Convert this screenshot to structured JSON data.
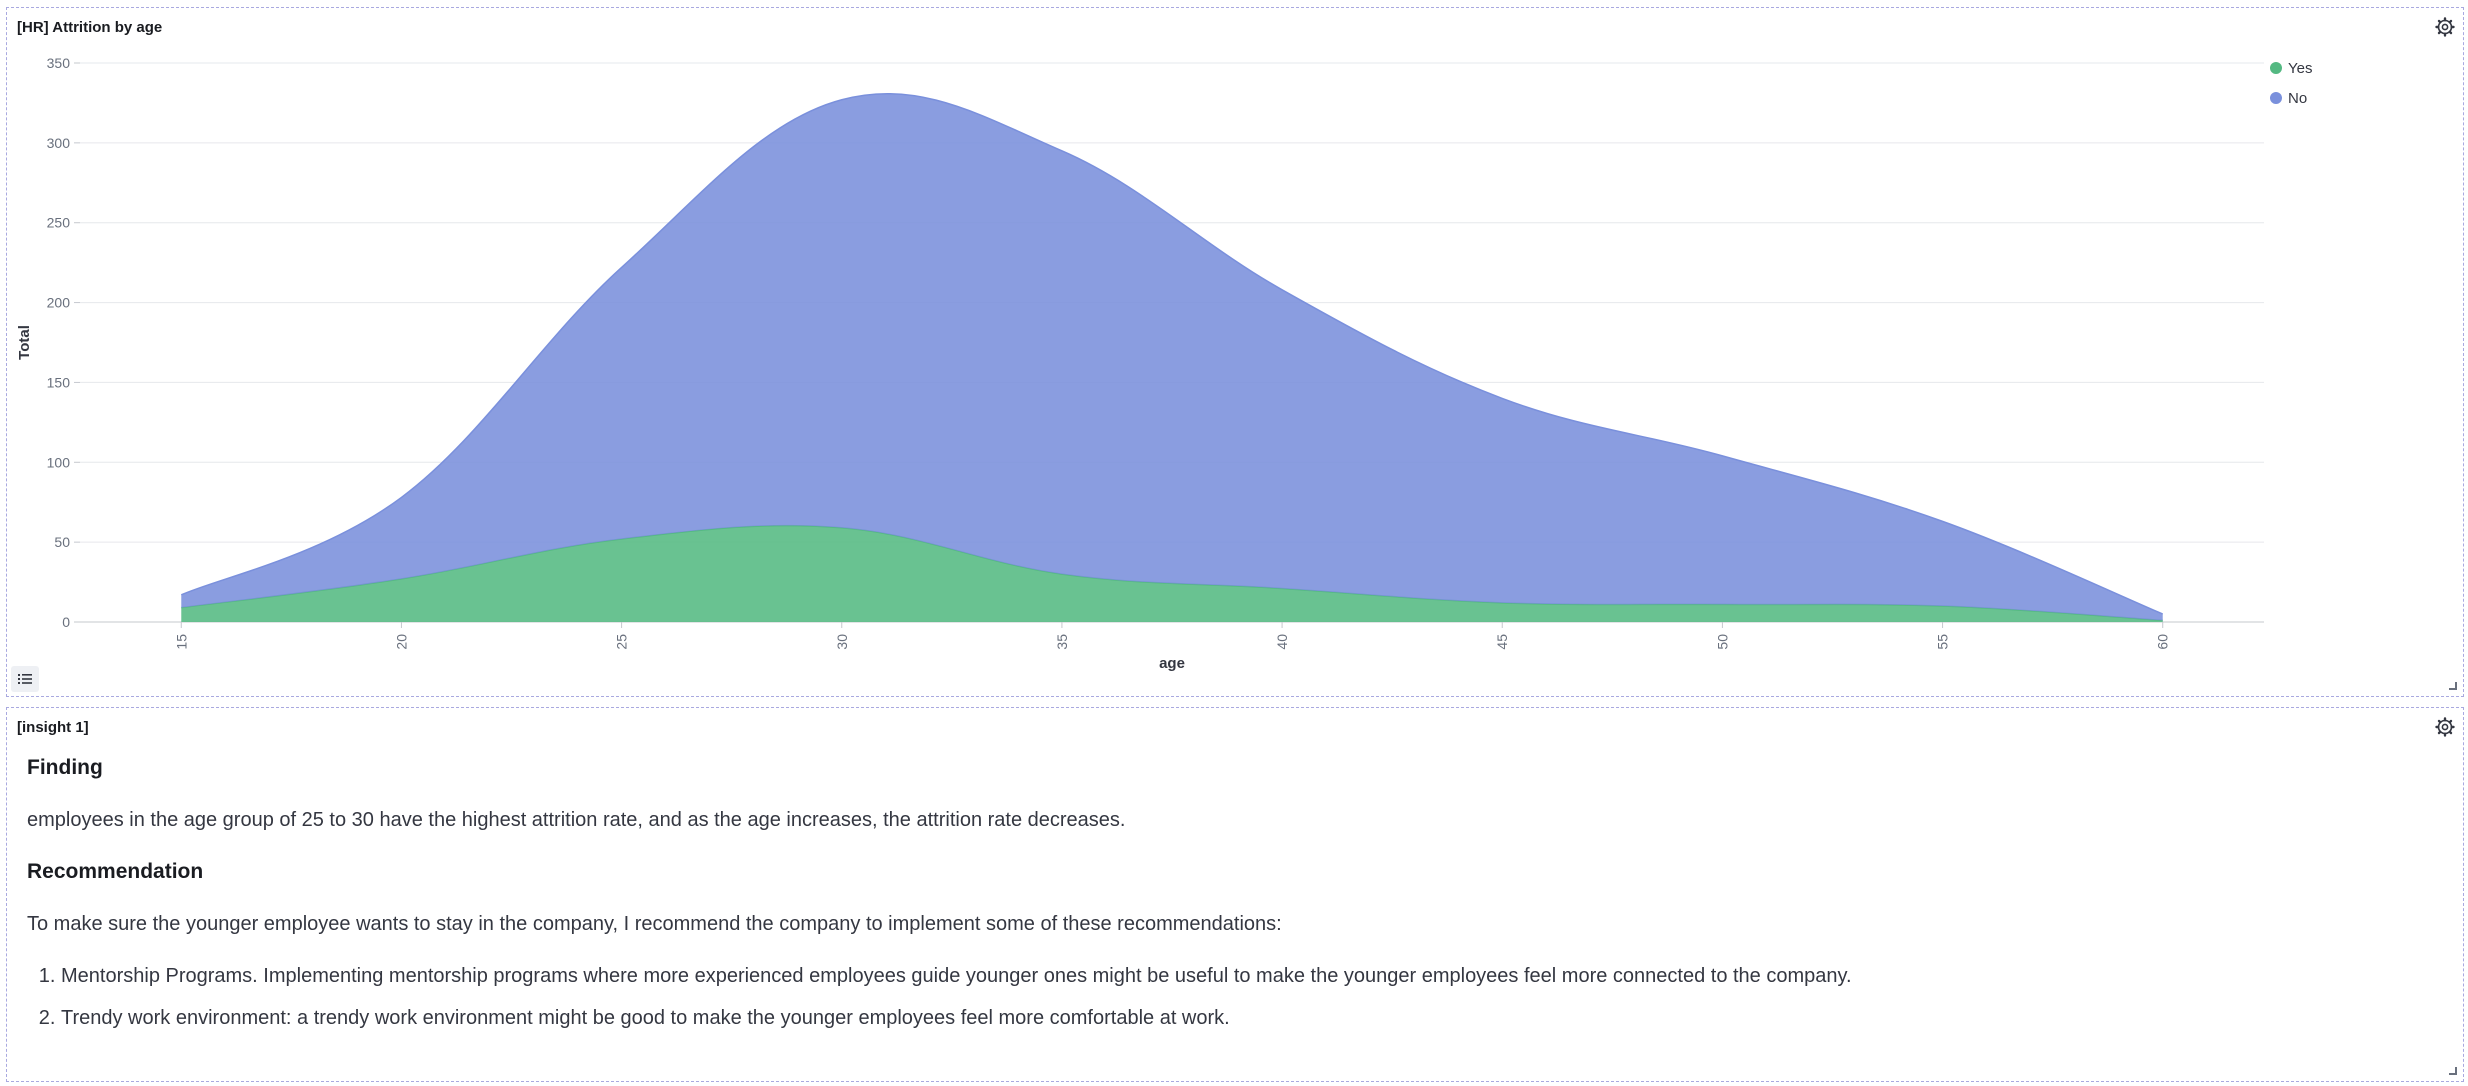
{
  "panels": {
    "chart_panel": {
      "title": "[HR] Attrition by age"
    },
    "insight_panel": {
      "title": "[insight 1]",
      "finding_heading": "Finding",
      "finding_text": "employees in the age group of 25 to 30 have the highest attrition rate, and as the age increases, the attrition rate decreases.",
      "recommendation_heading": "Recommendation",
      "recommendation_intro": "To make sure the younger employee wants to stay in the company, I recommend the company to implement some of these recommendations:",
      "recommendations": [
        "Mentorship Programs. Implementing mentorship programs where more experienced employees guide younger ones might be useful to make the younger employees feel more connected to the company.",
        "Trendy work environment: a trendy work environment might be good to make the younger employees feel more comfortable at work."
      ]
    }
  },
  "icons": {
    "settings": "gear-icon",
    "legend_toggle": "list-icon",
    "resize": "resize-handle-icon"
  },
  "chart_data": {
    "type": "area",
    "title": "[HR] Attrition by age",
    "xlabel": "age",
    "ylabel": "Total",
    "x": [
      15,
      20,
      25,
      30,
      35,
      40,
      45,
      50,
      55,
      60
    ],
    "xlim": [
      12.7,
      62.3
    ],
    "ylim": [
      0,
      350
    ],
    "y_ticks": [
      0,
      50,
      100,
      150,
      200,
      250,
      300,
      350
    ],
    "x_ticks": [
      15,
      20,
      25,
      30,
      35,
      40,
      45,
      50,
      55,
      60
    ],
    "stacked": true,
    "grid": true,
    "legend_position": "top-right",
    "series": [
      {
        "name": "Yes",
        "color": "#54B982",
        "values": [
          9,
          27,
          52,
          59,
          30,
          21,
          12,
          11,
          10,
          1
        ]
      },
      {
        "name": "No",
        "color": "#7A90DC",
        "values": [
          8,
          51,
          170,
          268,
          265,
          187,
          128,
          93,
          53,
          4
        ]
      }
    ]
  }
}
